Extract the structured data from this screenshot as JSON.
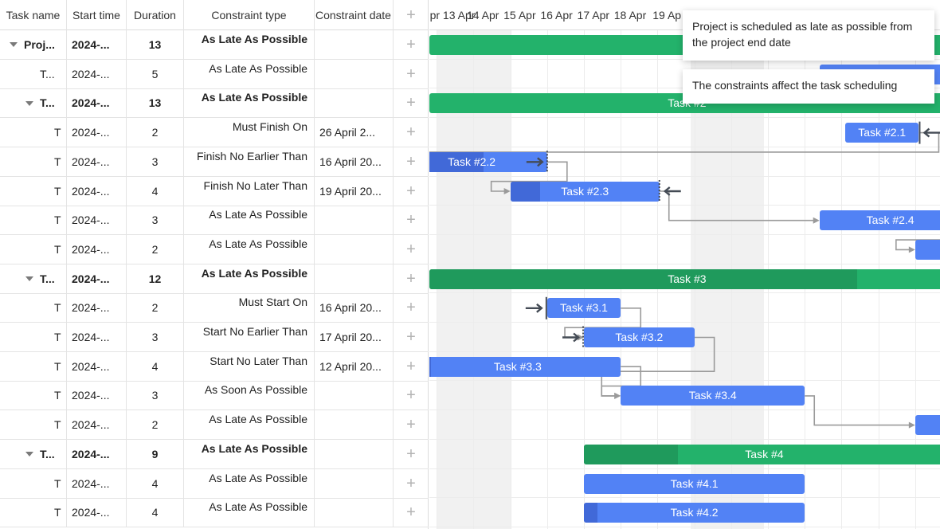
{
  "grid": {
    "columns": [
      "Task name",
      "Start time",
      "Duration",
      "Constraint type",
      "Constraint date"
    ],
    "add_icon": "plus-icon",
    "rows": [
      {
        "name": "Proj...",
        "start": "2024-...",
        "duration": "13",
        "ctype": "As Late As Possible",
        "cdate": "",
        "level": 0,
        "toggle": true,
        "bold": true
      },
      {
        "name": "T...",
        "start": "2024-...",
        "duration": "5",
        "ctype": "As Late As Possible",
        "cdate": "",
        "level": 1,
        "toggle": false,
        "bold": false
      },
      {
        "name": "T...",
        "start": "2024-...",
        "duration": "13",
        "ctype": "As Late As Possible",
        "cdate": "",
        "level": 1,
        "toggle": true,
        "bold": true
      },
      {
        "name": "T",
        "start": "2024-...",
        "duration": "2",
        "ctype": "Must Finish On",
        "cdate": "26 April 2...",
        "level": 2,
        "toggle": false,
        "bold": false
      },
      {
        "name": "T",
        "start": "2024-...",
        "duration": "3",
        "ctype": "Finish No Earlier Than",
        "cdate": "16 April 20...",
        "level": 2,
        "toggle": false,
        "bold": false
      },
      {
        "name": "T",
        "start": "2024-...",
        "duration": "4",
        "ctype": "Finish No Later Than",
        "cdate": "19 April 20...",
        "level": 2,
        "toggle": false,
        "bold": false
      },
      {
        "name": "T",
        "start": "2024-...",
        "duration": "3",
        "ctype": "As Late As Possible",
        "cdate": "",
        "level": 2,
        "toggle": false,
        "bold": false
      },
      {
        "name": "T",
        "start": "2024-...",
        "duration": "2",
        "ctype": "As Late As Possible",
        "cdate": "",
        "level": 2,
        "toggle": false,
        "bold": false
      },
      {
        "name": "T...",
        "start": "2024-...",
        "duration": "12",
        "ctype": "As Late As Possible",
        "cdate": "",
        "level": 1,
        "toggle": true,
        "bold": true
      },
      {
        "name": "T",
        "start": "2024-...",
        "duration": "2",
        "ctype": "Must Start On",
        "cdate": "16 April 20...",
        "level": 2,
        "toggle": false,
        "bold": false
      },
      {
        "name": "T",
        "start": "2024-...",
        "duration": "3",
        "ctype": "Start No Earlier Than",
        "cdate": "17 April 20...",
        "level": 2,
        "toggle": false,
        "bold": false
      },
      {
        "name": "T",
        "start": "2024-...",
        "duration": "4",
        "ctype": "Start No Later Than",
        "cdate": "12 April 20...",
        "level": 2,
        "toggle": false,
        "bold": false
      },
      {
        "name": "T",
        "start": "2024-...",
        "duration": "3",
        "ctype": "As Soon As Possible",
        "cdate": "",
        "level": 2,
        "toggle": false,
        "bold": false
      },
      {
        "name": "T",
        "start": "2024-...",
        "duration": "2",
        "ctype": "As Late As Possible",
        "cdate": "",
        "level": 2,
        "toggle": false,
        "bold": false
      },
      {
        "name": "T...",
        "start": "2024-...",
        "duration": "9",
        "ctype": "As Late As Possible",
        "cdate": "",
        "level": 1,
        "toggle": true,
        "bold": true
      },
      {
        "name": "T",
        "start": "2024-...",
        "duration": "4",
        "ctype": "As Late As Possible",
        "cdate": "",
        "level": 2,
        "toggle": false,
        "bold": false
      },
      {
        "name": "T",
        "start": "2024-...",
        "duration": "4",
        "ctype": "As Late As Possible",
        "cdate": "",
        "level": 2,
        "toggle": false,
        "bold": false
      }
    ]
  },
  "timeline": {
    "scale_labels": [
      "pr 13 Apr",
      "14 Apr",
      "15 Apr",
      "16 Apr",
      "17 Apr",
      "18 Apr",
      "19 Ap",
      "",
      "",
      "",
      "",
      "",
      "",
      "Ap"
    ],
    "bars": [
      {
        "row": 0,
        "type": "summary",
        "label": "",
        "start": 0,
        "end": 14,
        "progress": 0
      },
      {
        "row": 1,
        "type": "task",
        "label": "",
        "start": 10.6,
        "end": 14,
        "progress": 0
      },
      {
        "row": 2,
        "type": "summary",
        "label": "Task #2",
        "start": 0,
        "end": 14,
        "progress": 0
      },
      {
        "row": 3,
        "type": "task",
        "label": "Task #2.1",
        "start": 11.3,
        "end": 13.3,
        "progress": 0
      },
      {
        "row": 4,
        "type": "task",
        "label": "Task #2.2",
        "start": -0.9,
        "end": 3.2,
        "progress": 0.58
      },
      {
        "row": 5,
        "type": "task",
        "label": "Task #2.3",
        "start": 2.2,
        "end": 6.25,
        "progress": 0.2
      },
      {
        "row": 6,
        "type": "task",
        "label": "Task #2.4",
        "start": 10.6,
        "end": 14.45,
        "progress": 0
      },
      {
        "row": 7,
        "type": "task",
        "label": "",
        "start": 13.2,
        "end": 14,
        "progress": 0
      },
      {
        "row": 8,
        "type": "summary",
        "label": "Task #3",
        "start": 0,
        "end": 14,
        "progress": 0.83
      },
      {
        "row": 9,
        "type": "task",
        "label": "Task #3.1",
        "start": 3.2,
        "end": 5.2,
        "progress": 0
      },
      {
        "row": 10,
        "type": "task",
        "label": "Task #3.2",
        "start": 4.2,
        "end": 7.2,
        "progress": 0
      },
      {
        "row": 11,
        "type": "task",
        "label": "Task #3.3",
        "start": -0.4,
        "end": 5.2,
        "progress": 0.08
      },
      {
        "row": 12,
        "type": "task",
        "label": "Task #3.4",
        "start": 5.2,
        "end": 10.2,
        "progress": 0
      },
      {
        "row": 13,
        "type": "task",
        "label": "",
        "start": 13.2,
        "end": 14,
        "progress": 0
      },
      {
        "row": 14,
        "type": "summary",
        "label": "Task #4",
        "start": 4.2,
        "end": 14,
        "progress": 0.26
      },
      {
        "row": 15,
        "type": "task",
        "label": "Task #4.1",
        "start": 4.2,
        "end": 10.2,
        "progress": 0
      },
      {
        "row": 16,
        "type": "task",
        "label": "Task #4.2",
        "start": 4.2,
        "end": 10.2,
        "progress": 0.06
      }
    ]
  },
  "tooltips": {
    "project": "Project is scheduled as late as possible from the project end date",
    "constraints": "The constraints affect the task scheduling"
  },
  "colors": {
    "summary": "#23b26b",
    "summary_progress": "#1f9a5c",
    "task": "#5282f5",
    "task_progress": "#4169d8",
    "link": "#9a9a9a",
    "constraint_marker": "#444b55"
  }
}
